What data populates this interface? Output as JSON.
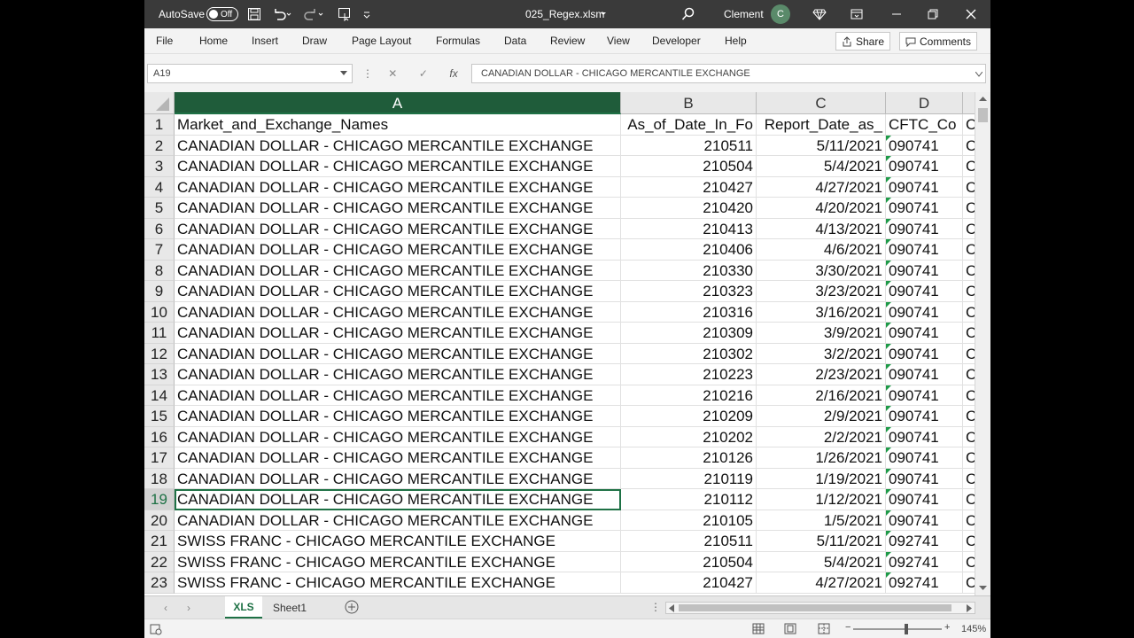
{
  "titlebar": {
    "autosave_label": "AutoSave",
    "autosave_state": "Off",
    "filename": "025_Regex.xlsm",
    "user_name": "Clement",
    "user_initial": "C"
  },
  "menu": [
    "File",
    "Home",
    "Insert",
    "Draw",
    "Page Layout",
    "Formulas",
    "Data",
    "Review",
    "View",
    "Developer",
    "Help"
  ],
  "share_label": "Share",
  "comments_label": "Comments",
  "formula_bar": {
    "name_box": "A19",
    "fx": "fx",
    "content": "CANADIAN DOLLAR - CHICAGO MERCANTILE EXCHANGE"
  },
  "columns": [
    "A",
    "B",
    "C",
    "D"
  ],
  "rows": [
    {
      "num": "1",
      "a": "Market_and_Exchange_Names",
      "b": "As_of_Date_In_Fo",
      "c": "Report_Date_as_",
      "d": "CFTC_Co",
      "e": "C"
    },
    {
      "num": "2",
      "a": "CANADIAN DOLLAR - CHICAGO MERCANTILE EXCHANGE",
      "b": "210511",
      "c": "5/11/2021",
      "d": "090741",
      "e": "C"
    },
    {
      "num": "3",
      "a": "CANADIAN DOLLAR - CHICAGO MERCANTILE EXCHANGE",
      "b": "210504",
      "c": "5/4/2021",
      "d": "090741",
      "e": "C"
    },
    {
      "num": "4",
      "a": "CANADIAN DOLLAR - CHICAGO MERCANTILE EXCHANGE",
      "b": "210427",
      "c": "4/27/2021",
      "d": "090741",
      "e": "C"
    },
    {
      "num": "5",
      "a": "CANADIAN DOLLAR - CHICAGO MERCANTILE EXCHANGE",
      "b": "210420",
      "c": "4/20/2021",
      "d": "090741",
      "e": "C"
    },
    {
      "num": "6",
      "a": "CANADIAN DOLLAR - CHICAGO MERCANTILE EXCHANGE",
      "b": "210413",
      "c": "4/13/2021",
      "d": "090741",
      "e": "C"
    },
    {
      "num": "7",
      "a": "CANADIAN DOLLAR - CHICAGO MERCANTILE EXCHANGE",
      "b": "210406",
      "c": "4/6/2021",
      "d": "090741",
      "e": "C"
    },
    {
      "num": "8",
      "a": "CANADIAN DOLLAR - CHICAGO MERCANTILE EXCHANGE",
      "b": "210330",
      "c": "3/30/2021",
      "d": "090741",
      "e": "C"
    },
    {
      "num": "9",
      "a": "CANADIAN DOLLAR - CHICAGO MERCANTILE EXCHANGE",
      "b": "210323",
      "c": "3/23/2021",
      "d": "090741",
      "e": "C"
    },
    {
      "num": "10",
      "a": "CANADIAN DOLLAR - CHICAGO MERCANTILE EXCHANGE",
      "b": "210316",
      "c": "3/16/2021",
      "d": "090741",
      "e": "C"
    },
    {
      "num": "11",
      "a": "CANADIAN DOLLAR - CHICAGO MERCANTILE EXCHANGE",
      "b": "210309",
      "c": "3/9/2021",
      "d": "090741",
      "e": "C"
    },
    {
      "num": "12",
      "a": "CANADIAN DOLLAR - CHICAGO MERCANTILE EXCHANGE",
      "b": "210302",
      "c": "3/2/2021",
      "d": "090741",
      "e": "C"
    },
    {
      "num": "13",
      "a": "CANADIAN DOLLAR - CHICAGO MERCANTILE EXCHANGE",
      "b": "210223",
      "c": "2/23/2021",
      "d": "090741",
      "e": "C"
    },
    {
      "num": "14",
      "a": "CANADIAN DOLLAR - CHICAGO MERCANTILE EXCHANGE",
      "b": "210216",
      "c": "2/16/2021",
      "d": "090741",
      "e": "C"
    },
    {
      "num": "15",
      "a": "CANADIAN DOLLAR - CHICAGO MERCANTILE EXCHANGE",
      "b": "210209",
      "c": "2/9/2021",
      "d": "090741",
      "e": "C"
    },
    {
      "num": "16",
      "a": "CANADIAN DOLLAR - CHICAGO MERCANTILE EXCHANGE",
      "b": "210202",
      "c": "2/2/2021",
      "d": "090741",
      "e": "C"
    },
    {
      "num": "17",
      "a": "CANADIAN DOLLAR - CHICAGO MERCANTILE EXCHANGE",
      "b": "210126",
      "c": "1/26/2021",
      "d": "090741",
      "e": "C"
    },
    {
      "num": "18",
      "a": "CANADIAN DOLLAR - CHICAGO MERCANTILE EXCHANGE",
      "b": "210119",
      "c": "1/19/2021",
      "d": "090741",
      "e": "C"
    },
    {
      "num": "19",
      "a": "CANADIAN DOLLAR - CHICAGO MERCANTILE EXCHANGE",
      "b": "210112",
      "c": "1/12/2021",
      "d": "090741",
      "e": "C"
    },
    {
      "num": "20",
      "a": "CANADIAN DOLLAR - CHICAGO MERCANTILE EXCHANGE",
      "b": "210105",
      "c": "1/5/2021",
      "d": "090741",
      "e": "C"
    },
    {
      "num": "21",
      "a": "SWISS FRANC - CHICAGO MERCANTILE EXCHANGE",
      "b": "210511",
      "c": "5/11/2021",
      "d": "092741",
      "e": "C"
    },
    {
      "num": "22",
      "a": "SWISS FRANC - CHICAGO MERCANTILE EXCHANGE",
      "b": "210504",
      "c": "5/4/2021",
      "d": "092741",
      "e": "C"
    },
    {
      "num": "23",
      "a": "SWISS FRANC - CHICAGO MERCANTILE EXCHANGE",
      "b": "210427",
      "c": "4/27/2021",
      "d": "092741",
      "e": "C"
    }
  ],
  "active_row": "19",
  "sheets": [
    "XLS",
    "Sheet1"
  ],
  "active_sheet": "XLS",
  "zoom": "145%",
  "colors": {
    "accent": "#1e7145",
    "titlebar": "#3a3a3a"
  }
}
